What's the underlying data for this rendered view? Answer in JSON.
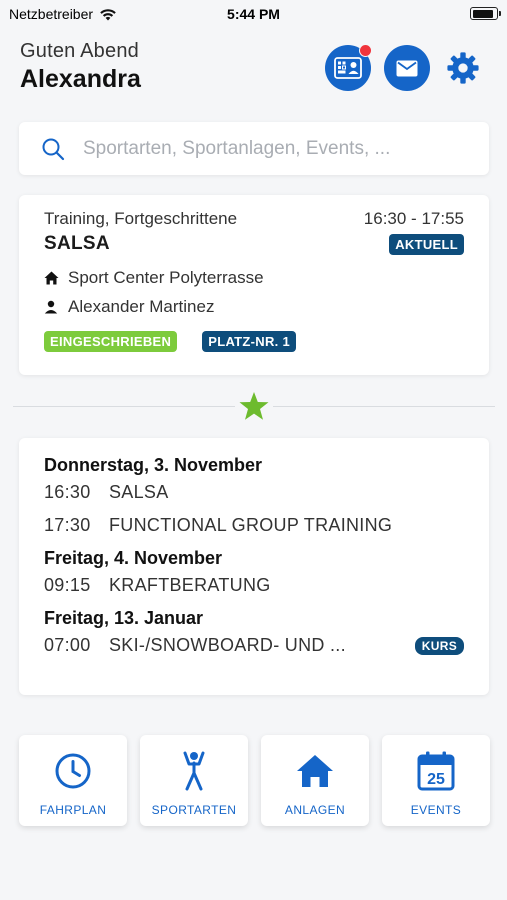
{
  "status_bar": {
    "carrier": "Netzbetreiber",
    "time": "5:44 PM",
    "battery_level": 0.9
  },
  "header": {
    "greeting": "Guten Abend",
    "name": "Alexandra"
  },
  "search": {
    "placeholder": "Sportarten, Sportanlagen, Events, ..."
  },
  "current_training": {
    "category": "Training, Fortgeschrittene",
    "time": "16:30 - 17:55",
    "title": "SALSA",
    "status_badge": "AKTUELL",
    "location": "Sport Center Polyterrasse",
    "instructor": "Alexander Martinez",
    "badges": [
      "EINGESCHRIEBEN",
      "PLATZ-NR. 1"
    ]
  },
  "schedule": [
    {
      "day": "Donnerstag, 3. November",
      "events": [
        {
          "time": "16:30",
          "name": "SALSA",
          "badge": ""
        },
        {
          "time": "17:30",
          "name": "FUNCTIONAL GROUP TRAINING",
          "badge": ""
        }
      ]
    },
    {
      "day": "Freitag, 4. November",
      "events": [
        {
          "time": "09:15",
          "name": "KRAFTBERATUNG",
          "badge": ""
        }
      ]
    },
    {
      "day": "Freitag, 13. Januar",
      "events": [
        {
          "time": "07:00",
          "name": "SKI-/SNOWBOARD- UND ...",
          "badge": "KURS"
        }
      ]
    }
  ],
  "tiles": [
    {
      "label": "FAHRPLAN",
      "icon": "clock-icon"
    },
    {
      "label": "SPORTARTEN",
      "icon": "athlete-icon"
    },
    {
      "label": "ANLAGEN",
      "icon": "home-icon"
    },
    {
      "label": "EVENTS",
      "icon": "calendar-icon",
      "calendar_day": "25"
    }
  ],
  "colors": {
    "primary": "#1565c8",
    "dark_badge": "#0e4d7c",
    "green": "#7dcb3c",
    "notification": "#f0343c"
  }
}
